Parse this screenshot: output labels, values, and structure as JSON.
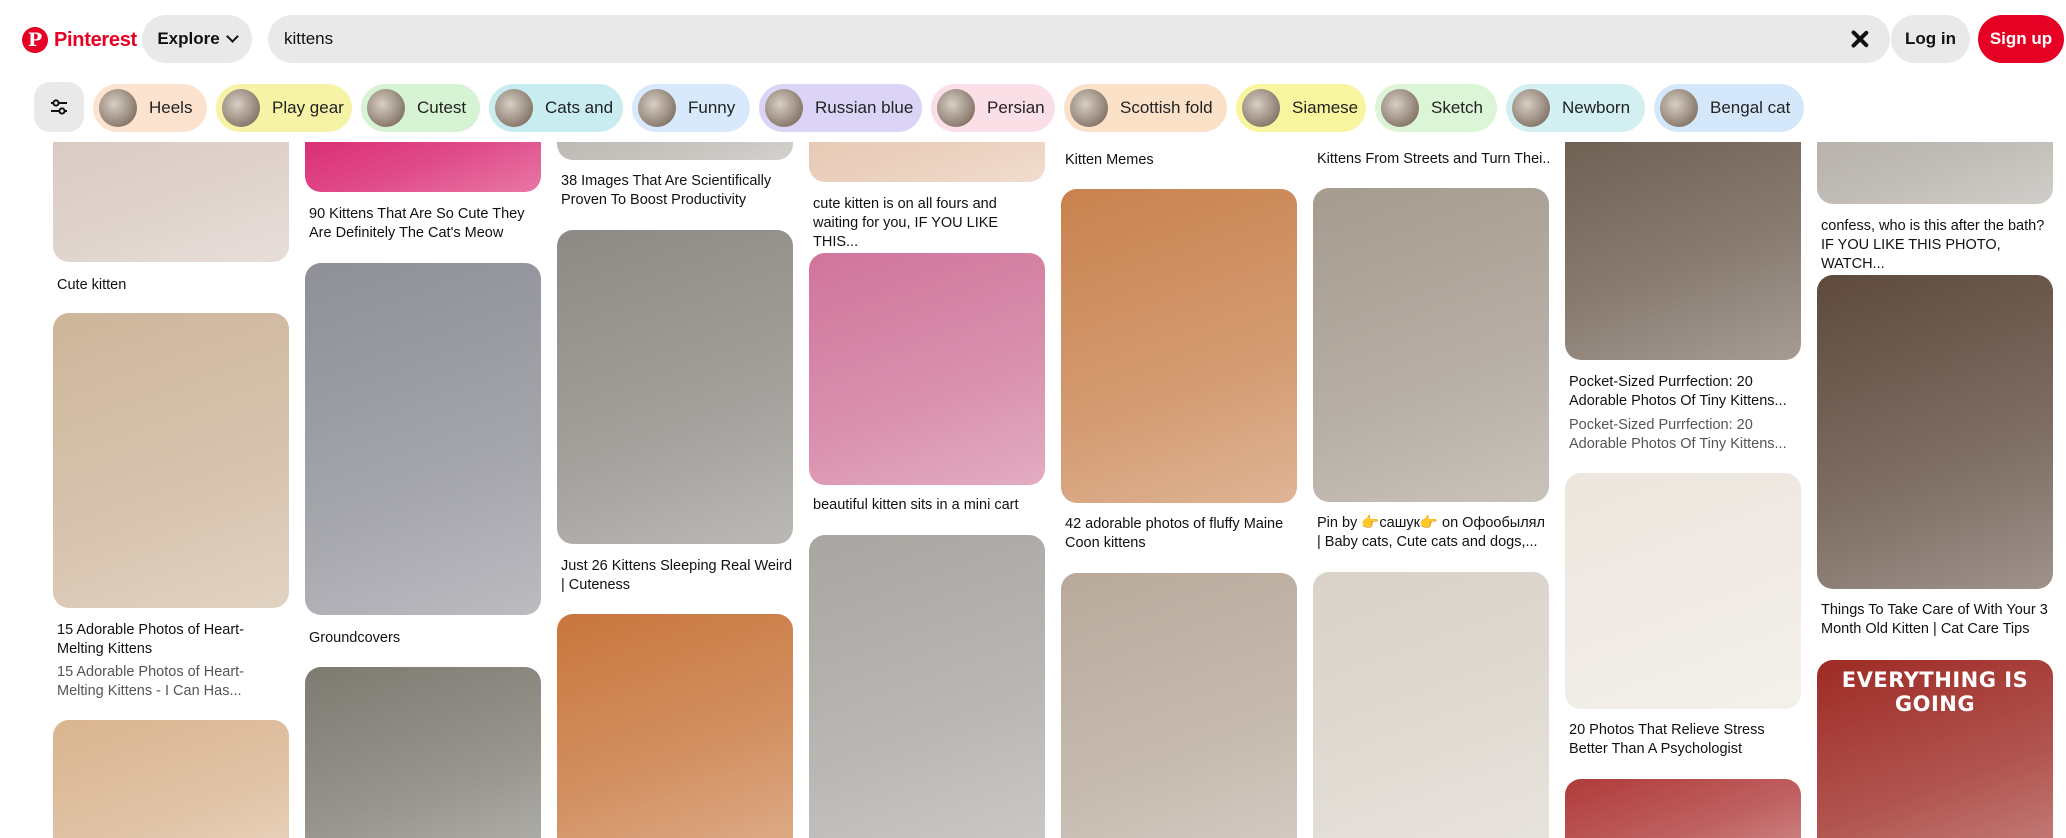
{
  "header": {
    "logo_text": "Pinterest",
    "explore_label": "Explore",
    "search_value": "kittens",
    "login_label": "Log in",
    "signup_label": "Sign up",
    "accent_color": "#e60023"
  },
  "chips": [
    {
      "label": "Heels",
      "color": "#fbe3cf"
    },
    {
      "label": "Play gear",
      "color": "#f6f3a6"
    },
    {
      "label": "Cutest",
      "color": "#d6f3d3"
    },
    {
      "label": "Cats and",
      "color": "#c9ecf1"
    },
    {
      "label": "Funny",
      "color": "#d7e9fb"
    },
    {
      "label": "Russian blue",
      "color": "#dcd4f6"
    },
    {
      "label": "Persian",
      "color": "#fbdfe6"
    },
    {
      "label": "Scottish fold",
      "color": "#fce1c9"
    },
    {
      "label": "Siamese",
      "color": "#f8f59f"
    },
    {
      "label": "Sketch",
      "color": "#dbf5d6"
    },
    {
      "label": "Newborn",
      "color": "#d2f0f2"
    },
    {
      "label": "Bengal cat",
      "color": "#d5e8fb"
    }
  ],
  "columns": [
    [
      {
        "title": "Cute kitten",
        "color": "#d8c8c0"
      },
      {
        "title": "15 Adorable Photos of Heart-Melting Kittens",
        "sub": "15 Adorable Photos of Heart-Melting Kittens - I Can Has...",
        "color": "#cdb59a"
      },
      {
        "title": "",
        "color": "#d9b48f"
      }
    ],
    [
      {
        "title": "90 Kittens That Are So Cute They Are Definitely The Cat's Meow",
        "color": "#d81d6a"
      },
      {
        "title": "Groundcovers",
        "color": "#8e8f97"
      },
      {
        "title": "",
        "color": "#7d7a71"
      }
    ],
    [
      {
        "title": "38 Images That Are Scientifically Proven To Boost Productivity",
        "color": "#b7b3ad"
      },
      {
        "title": "Just 26 Kittens Sleeping Real Weird | Cuteness",
        "color": "#8d8984"
      },
      {
        "title": "",
        "color": "#c8763c"
      }
    ],
    [
      {
        "title": "cute kitten is on all fours and waiting for you, IF YOU LIKE THIS...",
        "color": "#e6c5ae"
      },
      {
        "title": "beautiful kitten sits in a mini cart",
        "color": "#d0759a"
      },
      {
        "title": "",
        "color": "#a9a5a1"
      }
    ],
    [
      {
        "title": "Kitten Memes",
        "color": "#d8d3cc"
      },
      {
        "title": "42 adorable photos of fluffy Maine Coon kittens",
        "color": "#c9824e"
      },
      {
        "title": "",
        "color": "#b8a99b"
      }
    ],
    [
      {
        "title": "Kittens From Streets and Turn Thei...",
        "color": "#c7c3bd"
      },
      {
        "title": "Pin by 👉сашук👉 on Офообылял | Baby cats, Cute cats and dogs,...",
        "color": "#a59b8f"
      },
      {
        "title": "",
        "color": "#d9d2c8"
      }
    ],
    [
      {
        "title": "Pocket-Sized Purrfection: 20 Adorable Photos Of Tiny Kittens...",
        "sub": "Pocket-Sized Purrfection: 20 Adorable Photos Of Tiny Kittens...",
        "color": "#6a5a4d"
      },
      {
        "title": "20 Photos That Relieve Stress Better Than A Psychologist",
        "color": "#ece6de"
      },
      {
        "title": "",
        "color": "#b03a3a"
      }
    ],
    [
      {
        "title": "confess, who is this after the bath? IF YOU LIKE THIS PHOTO, WATCH...",
        "color": "#b2aca6"
      },
      {
        "title": "Things To Take Care of With Your 3 Month Old Kitten | Cat Care Tips",
        "color": "#5e4a3d"
      },
      {
        "title": "EVERYTHING IS GOING",
        "color": "#9e2a24"
      }
    ]
  ]
}
